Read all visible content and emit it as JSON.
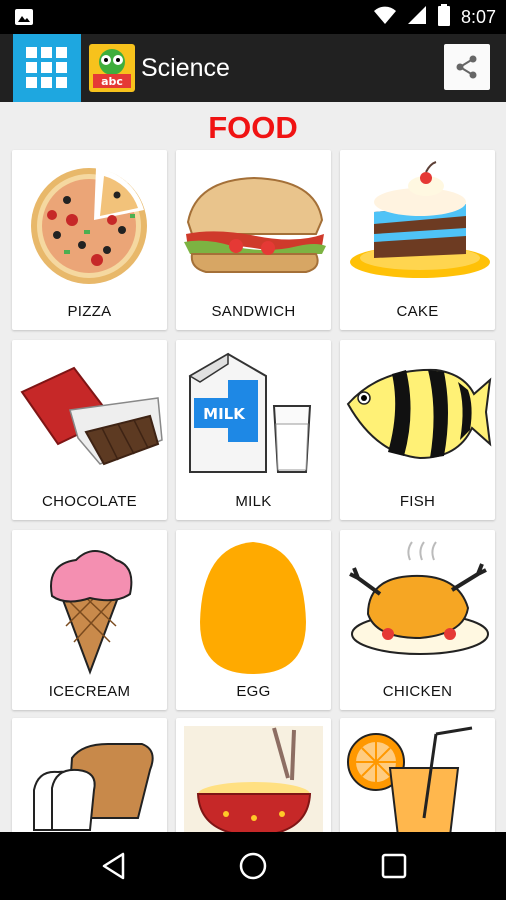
{
  "status_bar": {
    "time": "8:07",
    "icons": [
      "image-notification-icon",
      "wifi-icon",
      "cell-signal-icon",
      "battery-icon"
    ]
  },
  "app_bar": {
    "title": "Science",
    "menu_icon": "grid-menu-icon",
    "logo_icon": "app-logo-icon",
    "share_icon": "share-icon",
    "accent_color": "#1ea7e0"
  },
  "page": {
    "heading": "FOOD",
    "heading_color": "#f01313"
  },
  "items": [
    {
      "label": "PIZZA",
      "icon": "pizza-icon"
    },
    {
      "label": "SANDWICH",
      "icon": "sandwich-icon"
    },
    {
      "label": "CAKE",
      "icon": "cake-icon"
    },
    {
      "label": "CHOCOLATE",
      "icon": "chocolate-icon"
    },
    {
      "label": "MILK",
      "icon": "milk-icon"
    },
    {
      "label": "FISH",
      "icon": "fish-icon"
    },
    {
      "label": "ICECREAM",
      "icon": "icecream-icon"
    },
    {
      "label": "EGG",
      "icon": "egg-icon"
    },
    {
      "label": "CHICKEN",
      "icon": "chicken-icon"
    },
    {
      "label": "",
      "icon": "bread-icon"
    },
    {
      "label": "",
      "icon": "noodles-icon"
    },
    {
      "label": "",
      "icon": "orange-juice-icon"
    }
  ],
  "nav_bar": {
    "icons": [
      "back-icon",
      "home-icon",
      "recents-icon"
    ]
  }
}
